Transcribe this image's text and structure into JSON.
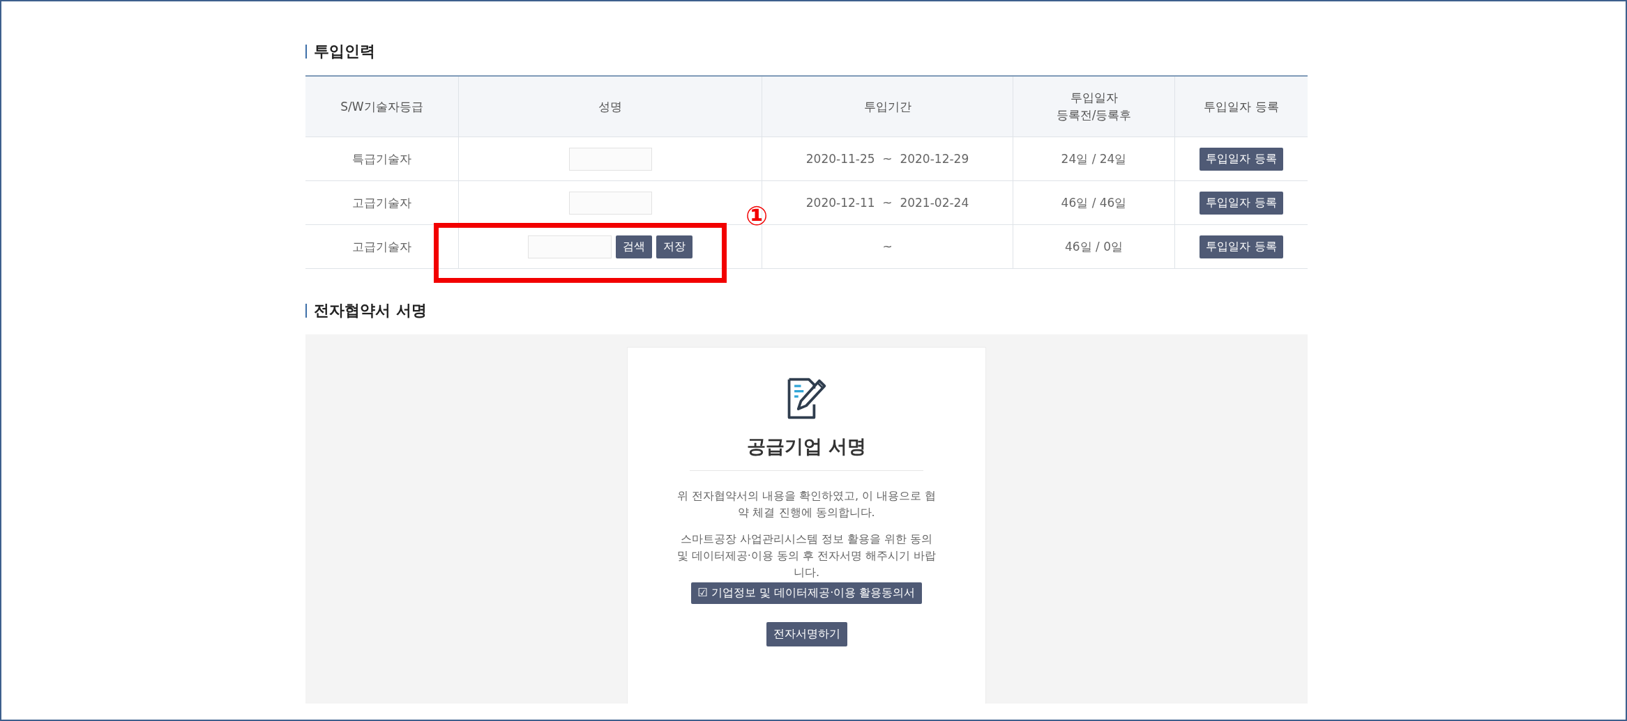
{
  "sections": [
    {
      "kind": "table",
      "title": "투입인력",
      "columns": [
        {
          "label": "S/W기술자등급"
        },
        {
          "label": "성명"
        },
        {
          "label": "투입기간"
        },
        {
          "label": "투입일자\n등록전/등록후"
        },
        {
          "label": "투입일자 등록"
        }
      ],
      "rows": [
        {
          "grade": "특급기술자",
          "name": {
            "kind": "input"
          },
          "period": "2020-11-25  ~  2020-12-29",
          "days": "24일 / 24일",
          "button": "투입일자 등록"
        },
        {
          "grade": "고급기술자",
          "name": {
            "kind": "input"
          },
          "period": "2020-12-11  ~  2021-02-24",
          "days": "46일 / 46일",
          "button": "투입일자 등록"
        },
        {
          "grade": "고급기술자",
          "name": {
            "kind": "search",
            "buttons": [
              "검색",
              "저장"
            ]
          },
          "period": "~",
          "days": "46일 / 0일",
          "button": "투입일자 등록",
          "annotation": "①"
        }
      ]
    },
    {
      "kind": "sign",
      "title": "전자협약서 서명",
      "card": {
        "title": "공급기업 서명",
        "paragraphs": [
          "위 전자협약서의 내용을 확인하였고, 이 내용으로 협약 체결 진행에 동의합니다.",
          "스마트공장 사업관리시스템 정보 활용을 위한 동의 및 데이터제공·이용 동의 후 전자서명 해주시기 바랍니다."
        ],
        "buttons": [
          "☑ 기업정보 및 데이터제공·이용 활용동의서",
          "전자서명하기"
        ]
      }
    }
  ]
}
